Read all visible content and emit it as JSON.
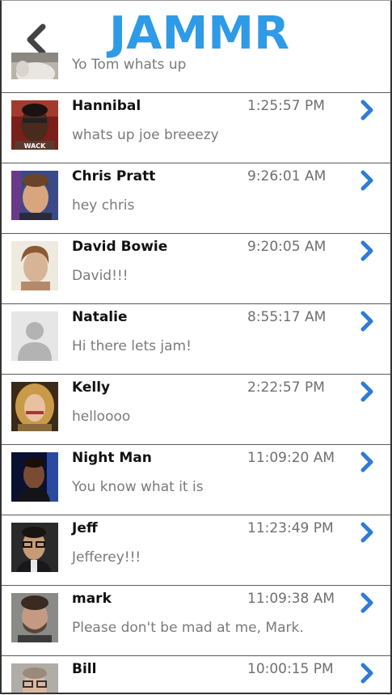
{
  "header": {
    "logo_text": "JAMMR",
    "back_icon": "chevron-left-icon",
    "brand_color": "#2f9be6"
  },
  "peek": {
    "message": "Yo Tom whats up"
  },
  "conversations": [
    {
      "name": "Hannibal",
      "time": "1:25:57 PM",
      "message": "whats up joe breeezy",
      "avatar_caption": "WACK"
    },
    {
      "name": "Chris Pratt",
      "time": "9:26:01 AM",
      "message": "hey chris"
    },
    {
      "name": "David Bowie",
      "time": "9:20:05 AM",
      "message": "David!!!"
    },
    {
      "name": "Natalie",
      "time": "8:55:17 AM",
      "message": "Hi there lets jam!"
    },
    {
      "name": "Kelly",
      "time": "2:22:57 PM",
      "message": "helloooo"
    },
    {
      "name": "Night Man",
      "time": "11:09:20 AM",
      "message": "You know what it is"
    },
    {
      "name": "Jeff",
      "time": "11:23:49 PM",
      "message": "Jefferey!!!"
    },
    {
      "name": "mark",
      "time": "11:09:38 AM",
      "message": "Please don't be mad at me, Mark."
    },
    {
      "name": "Bill",
      "time": "10:00:15 PM",
      "message": ""
    }
  ],
  "colors": {
    "chevron": "#2f7bd6",
    "divider": "#5a5a5a",
    "name_text": "#111111",
    "muted_text": "#7a7a7a"
  }
}
